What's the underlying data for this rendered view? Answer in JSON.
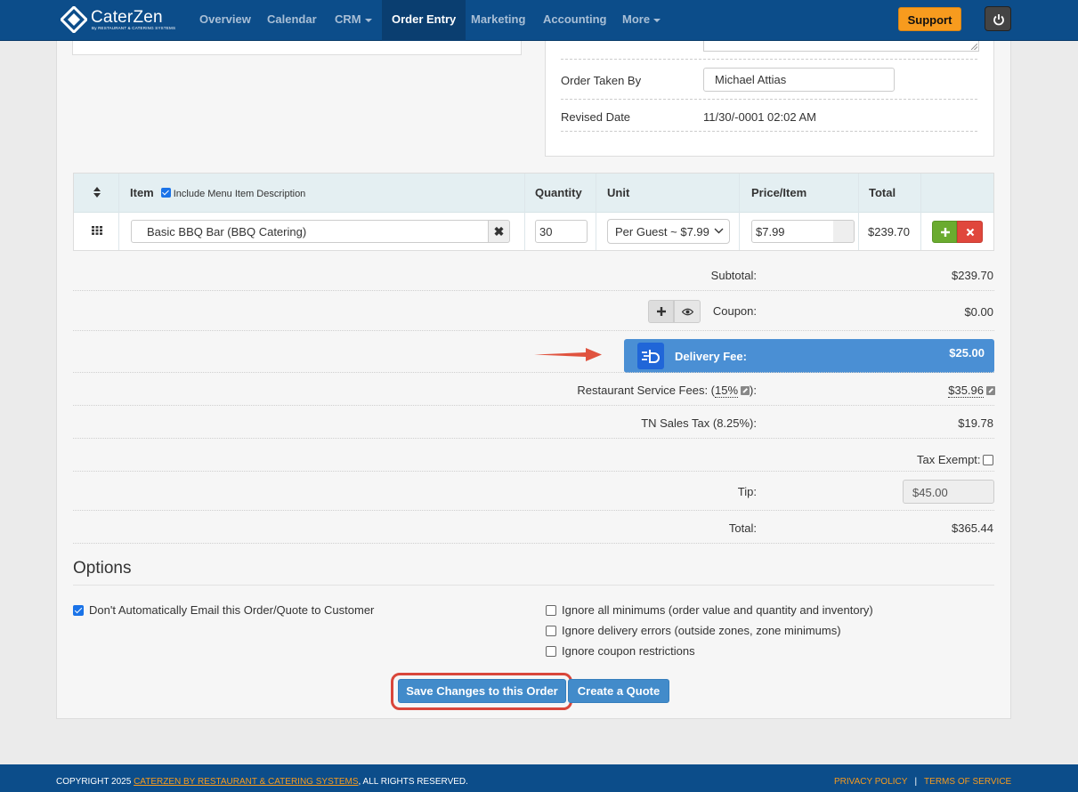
{
  "nav": {
    "brand": "CaterZen",
    "brand_sub": "By RESTAURANT & CATERING SYSTEMS",
    "items": [
      "Overview",
      "Calendar",
      "CRM",
      "Order Entry",
      "Marketing",
      "Accounting",
      "More"
    ],
    "active": "Order Entry",
    "support_label": "Support"
  },
  "order_info": {
    "taken_by_label": "Order Taken By",
    "taken_by_value": "Michael Attias",
    "revised_date_label": "Revised Date",
    "revised_date_value": "11/30/-0001 02:02 AM"
  },
  "items_table": {
    "headers": {
      "item": "Item",
      "include_desc": "Include Menu Item Description",
      "quantity": "Quantity",
      "unit": "Unit",
      "price": "Price/Item",
      "total": "Total"
    },
    "rows": [
      {
        "item": "Basic BBQ Bar (BBQ Catering)",
        "quantity": "30",
        "unit": "Per Guest ~ $7.99",
        "price": "$7.99",
        "total": "$239.70"
      }
    ]
  },
  "totals": {
    "subtotal_label": "Subtotal:",
    "subtotal": "$239.70",
    "coupon_label": "Coupon:",
    "coupon": "$0.00",
    "delivery_label": "Delivery Fee:",
    "delivery": "$25.00",
    "service_label_pre": "Restaurant Service Fees: (",
    "service_pct": "15%",
    "service_label_post": "):",
    "service": "$35.96",
    "tax_label": "TN Sales Tax (8.25%):",
    "tax": "$19.78",
    "tax_exempt_label": "Tax Exempt:",
    "tip_label": "Tip:",
    "tip": "$45.00",
    "total_label": "Total:",
    "total": "$365.44"
  },
  "options": {
    "title": "Options",
    "left": [
      {
        "label": "Don't Automatically Email this Order/Quote to Customer",
        "checked": true
      }
    ],
    "right": [
      {
        "label": "Ignore all minimums (order value and quantity and inventory)",
        "checked": false
      },
      {
        "label": "Ignore delivery errors (outside zones, zone minimums)",
        "checked": false
      },
      {
        "label": "Ignore coupon restrictions",
        "checked": false
      }
    ]
  },
  "actions": {
    "save": "Save Changes to this Order",
    "quote": "Create a Quote"
  },
  "footer": {
    "copyright_pre": "COPYRIGHT 2025 ",
    "copyright_link": "CATERZEN BY RESTAURANT & CATERING SYSTEMS",
    "copyright_post": ", ALL RIGHTS RESERVED.",
    "privacy": "PRIVACY POLICY",
    "terms": "TERMS OF SERVICE"
  },
  "colors": {
    "nav_bg": "#0c4d8a",
    "accent_orange": "#f79b1e",
    "primary_blue": "#428bca",
    "delivery_blue": "#4a8fd4",
    "success_green": "#6aab2f",
    "danger_red": "#e0473c",
    "highlight_red": "#d9463a"
  },
  "icons": [
    "caterzen-logo-icon",
    "power-icon",
    "sort-icon",
    "drag-grid-icon",
    "clear-icon",
    "chevron-down-icon",
    "plus-icon",
    "remove-icon",
    "eye-icon",
    "delivery-service-icon",
    "arrow-right-icon",
    "edit-pencil-icon"
  ]
}
